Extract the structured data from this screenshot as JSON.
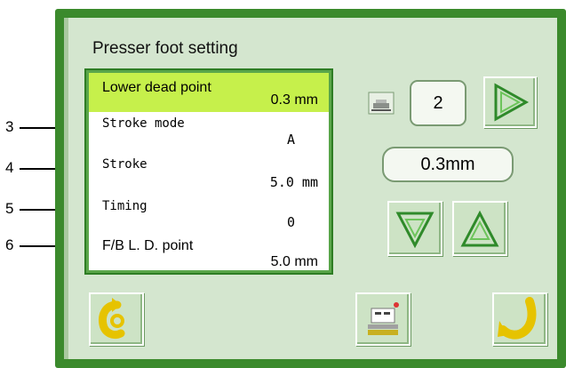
{
  "screen": {
    "title": "Presser foot setting"
  },
  "settings": [
    {
      "label": "Lower dead point",
      "value": "0.3 mm",
      "selected": true
    },
    {
      "label": "Stroke mode",
      "value": "A",
      "selected": false
    },
    {
      "label": "Stroke",
      "value": "5.0 mm",
      "selected": false
    },
    {
      "label": "Timing",
      "value": "0",
      "selected": false
    },
    {
      "label": "F/B L. D. point",
      "value": "5.0 mm",
      "selected": false
    }
  ],
  "callouts": [
    "3",
    "4",
    "5",
    "6"
  ],
  "controls": {
    "page_number": "2",
    "current_value": "0.3mm"
  },
  "icons": {
    "page_icon": "presser-page-icon",
    "next": "right-triangle-icon",
    "down": "down-triangle-icon",
    "up": "up-triangle-icon",
    "back": "return-arrow-icon",
    "machine": "machine-settings-icon",
    "enter": "enter-arrow-icon"
  },
  "colors": {
    "frame": "#3b8a2c",
    "screen_bg": "#d4e6cf",
    "selected_row": "#c6f04b"
  }
}
